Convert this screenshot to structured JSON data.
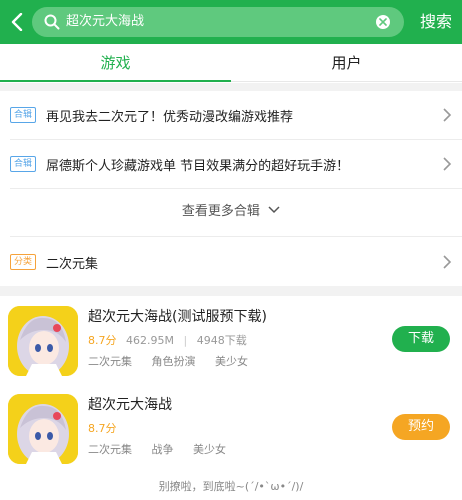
{
  "header": {
    "search_query": "超次元大海战",
    "search_button": "搜索",
    "colors": {
      "brand": "#21b04e",
      "search_bg": "#5fc97e"
    }
  },
  "tabs": [
    {
      "label": "游戏",
      "active": true
    },
    {
      "label": "用户",
      "active": false
    }
  ],
  "collections": [
    {
      "tag": "合辑",
      "text": "再见我去二次元了！优秀动漫改编游戏推荐"
    },
    {
      "tag": "合辑",
      "text": "屌德斯个人珍藏游戏单 节目效果满分的超好玩手游！"
    }
  ],
  "more_label": "查看更多合辑",
  "category": {
    "tag": "分类",
    "text": "二次元集"
  },
  "games": [
    {
      "title": "超次元大海战(测试服预下载)",
      "score": "8.7分",
      "size": "462.95M",
      "downloads": "4948下载",
      "tags": [
        "二次元集",
        "角色扮演",
        "美少女"
      ],
      "action": "下载",
      "action_color": "#21b04e"
    },
    {
      "title": "超次元大海战",
      "score": "8.7分",
      "tags": [
        "二次元集",
        "战争",
        "美少女"
      ],
      "action": "预约",
      "action_color": "#f5a623"
    }
  ],
  "footer": "别撩啦，到底啦~(ˊ/•ˋω•ˊ/)/"
}
